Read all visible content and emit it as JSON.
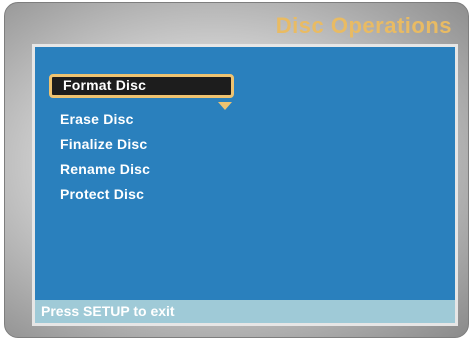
{
  "window": {
    "title": "Disc Operations"
  },
  "colors": {
    "title": "#e9bb63",
    "panel": "#2a80bd",
    "selection_border": "#eec371",
    "selection_fill": "#1d1d1d",
    "footer": "#9fcad7"
  },
  "menu": {
    "selected_index": 0,
    "items": [
      {
        "label": "Format Disc"
      },
      {
        "label": "Erase Disc"
      },
      {
        "label": "Finalize Disc"
      },
      {
        "label": "Rename Disc"
      },
      {
        "label": "Protect Disc"
      }
    ],
    "scroll_indicator_icon": "triangle-down-icon"
  },
  "footer": {
    "hint": "Press SETUP to exit"
  }
}
